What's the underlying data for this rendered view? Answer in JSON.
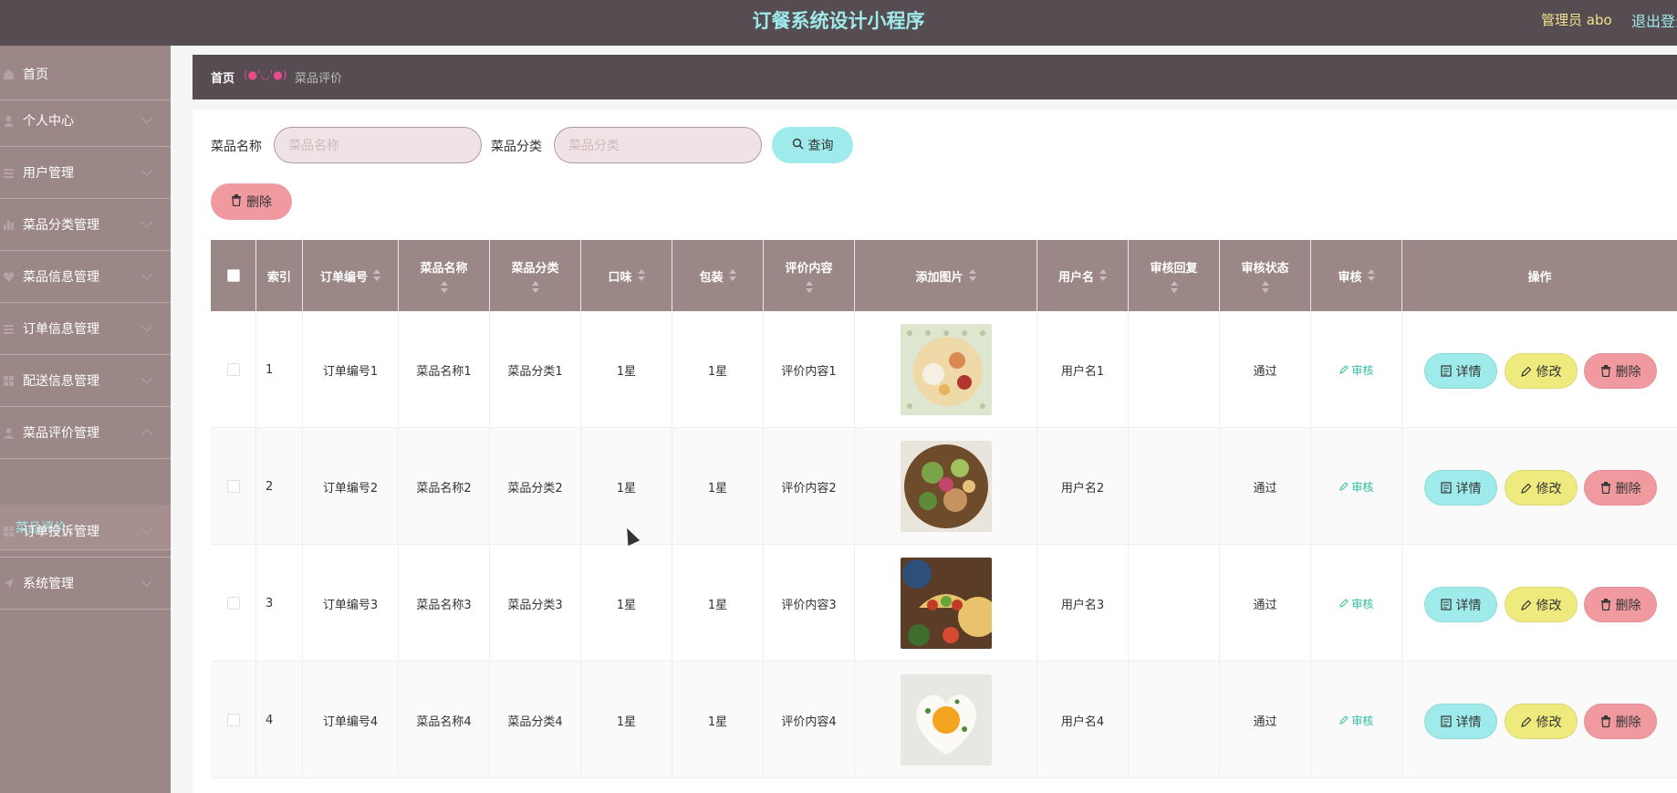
{
  "app": {
    "title": "订餐系统设计小程序",
    "user_label": "管理员 abo",
    "logout_label": "退出登录"
  },
  "sidebar": {
    "items": [
      {
        "label": "首页",
        "icon": "home-icon"
      },
      {
        "label": "个人中心",
        "icon": "user-icon"
      },
      {
        "label": "用户管理",
        "icon": "list-icon"
      },
      {
        "label": "菜品分类管理",
        "icon": "chart-icon"
      },
      {
        "label": "菜品信息管理",
        "icon": "heart-icon"
      },
      {
        "label": "订单信息管理",
        "icon": "list-icon"
      },
      {
        "label": "配送信息管理",
        "icon": "grid-icon"
      },
      {
        "label": "菜品评价管理",
        "icon": "user-icon"
      },
      {
        "label": "订单投诉管理",
        "icon": "grid-icon"
      },
      {
        "label": "系统管理",
        "icon": "send-icon"
      }
    ],
    "active_sub": "菜品评价"
  },
  "breadcrumb": {
    "home": "首页",
    "separator": "(●'◡'●)",
    "current": "菜品评价"
  },
  "search": {
    "name_label": "菜品名称",
    "name_placeholder": "菜品名称",
    "category_label": "菜品分类",
    "category_placeholder": "菜品分类",
    "query_label": "查询",
    "delete_label": "删除"
  },
  "table": {
    "headers": [
      "索引",
      "订单编号",
      "菜品名称",
      "菜品分类",
      "口味",
      "包装",
      "评价内容",
      "添加图片",
      "用户名",
      "审核回复",
      "审核状态",
      "审核",
      "操作"
    ],
    "rows": [
      {
        "index": "1",
        "order_no": "订单编号1",
        "dish_name": "菜品名称1",
        "dish_category": "菜品分类1",
        "taste": "1星",
        "packaging": "1星",
        "content": "评价内容1",
        "username": "用户名1",
        "reply": "",
        "status": "通过",
        "audit": "审核"
      },
      {
        "index": "2",
        "order_no": "订单编号2",
        "dish_name": "菜品名称2",
        "dish_category": "菜品分类2",
        "taste": "1星",
        "packaging": "1星",
        "content": "评价内容2",
        "username": "用户名2",
        "reply": "",
        "status": "通过",
        "audit": "审核"
      },
      {
        "index": "3",
        "order_no": "订单编号3",
        "dish_name": "菜品名称3",
        "dish_category": "菜品分类3",
        "taste": "1星",
        "packaging": "1星",
        "content": "评价内容3",
        "username": "用户名3",
        "reply": "",
        "status": "通过",
        "audit": "审核"
      },
      {
        "index": "4",
        "order_no": "订单编号4",
        "dish_name": "菜品名称4",
        "dish_category": "菜品分类4",
        "taste": "1星",
        "packaging": "1星",
        "content": "评价内容4",
        "username": "用户名4",
        "reply": "",
        "status": "通过",
        "audit": "审核"
      }
    ],
    "actions": {
      "detail": "详情",
      "edit": "修改",
      "delete": "删除"
    }
  },
  "colors": {
    "topbar": "#554d52",
    "sidebar": "#9c8787",
    "accent_cyan": "#9feaeb",
    "accent_yellow": "#eeea7e",
    "accent_red": "#f09a9f",
    "audit_green": "#2ebd9e"
  }
}
